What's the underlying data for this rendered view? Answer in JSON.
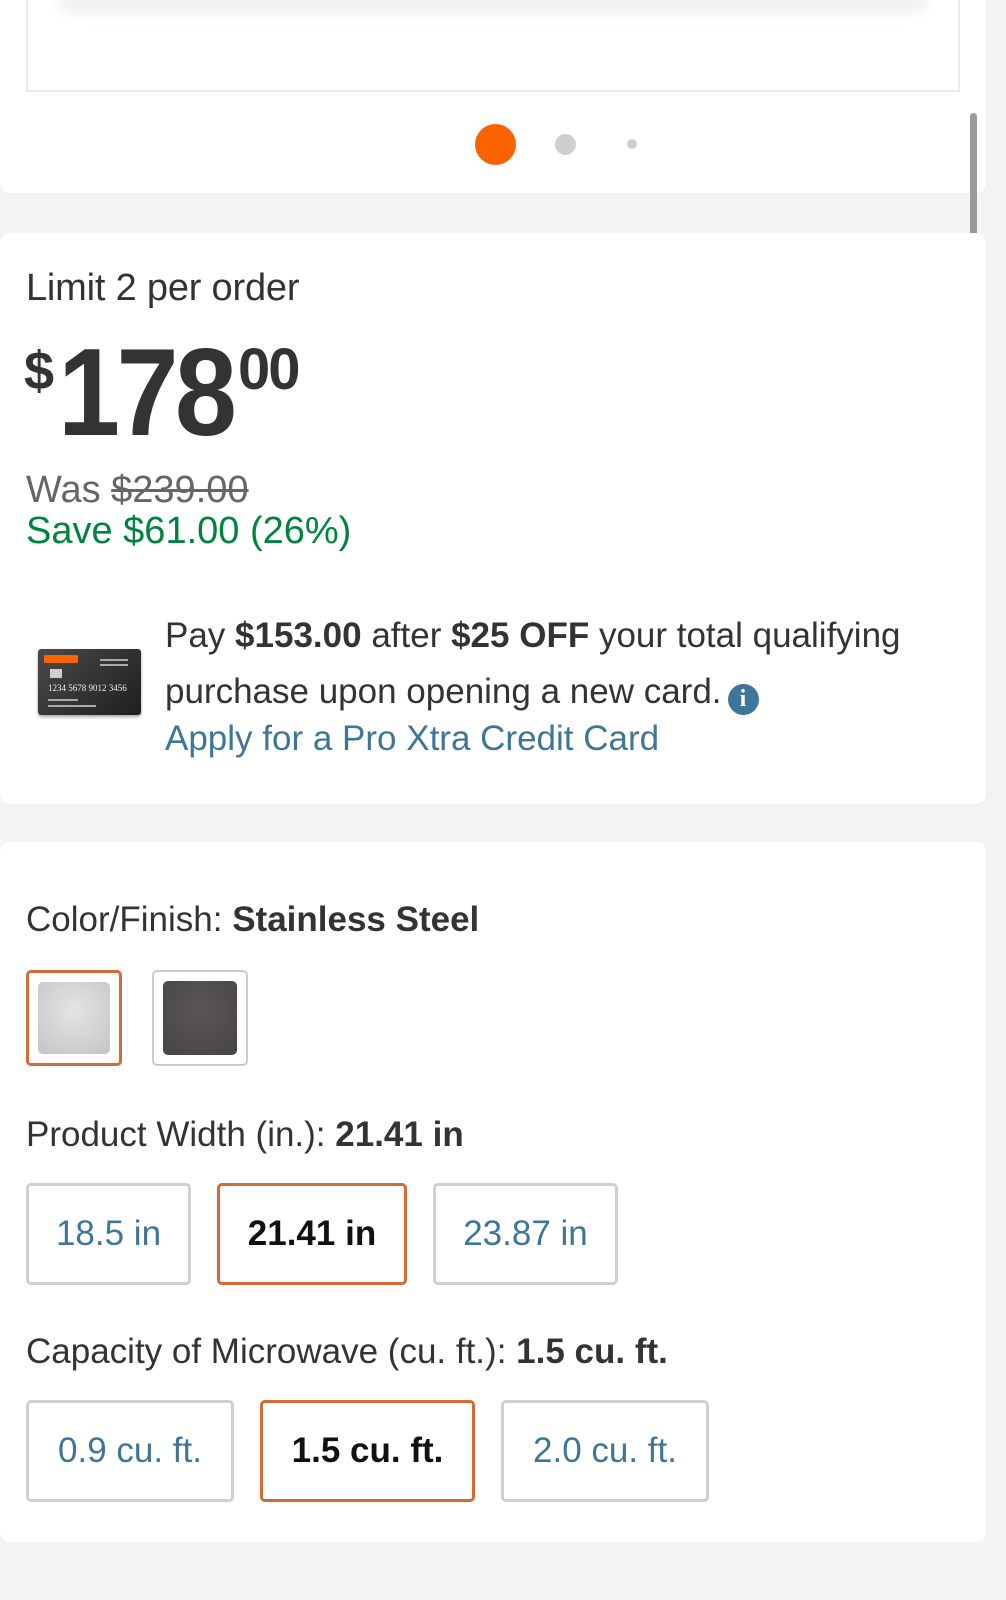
{
  "carousel": {
    "dots": [
      "image-1",
      "image-2",
      "image-3"
    ],
    "active_index": 0,
    "active_color": "#f96302"
  },
  "pricing": {
    "limit_text": "Limit 2 per order",
    "currency_symbol": "$",
    "dollars": "178",
    "cents": "00",
    "was_label": "Was",
    "was_price": "$239.00",
    "save_text": "Save $61.00 (26%)",
    "save_color": "#00843d"
  },
  "credit_offer": {
    "card_number": "1234 5678 9012 3456",
    "text_pay": "Pay",
    "amount": "$153.00",
    "text_after": "after",
    "discount": "$25 OFF",
    "text_rest": "your total qualifying purchase upon opening a new card.",
    "info_icon": "info-icon",
    "apply_link": "Apply for a Pro Xtra Credit Card",
    "link_color": "#3e7697"
  },
  "options": {
    "color": {
      "label": "Color/Finish:",
      "selected": "Stainless Steel",
      "swatches": [
        {
          "name": "Stainless Steel",
          "color": "#d4d4d4",
          "selected": true
        },
        {
          "name": "Black Stainless",
          "color": "#4f4c4c",
          "selected": false
        }
      ]
    },
    "width": {
      "label": "Product Width (in.):",
      "selected": "21.41 in",
      "choices": [
        "18.5 in",
        "21.41 in",
        "23.87 in"
      ]
    },
    "capacity": {
      "label": "Capacity of Microwave (cu. ft.):",
      "selected": "1.5 cu. ft.",
      "choices": [
        "0.9 cu. ft.",
        "1.5 cu. ft.",
        "2.0 cu. ft."
      ]
    },
    "selected_border_color": "#d36b32"
  }
}
